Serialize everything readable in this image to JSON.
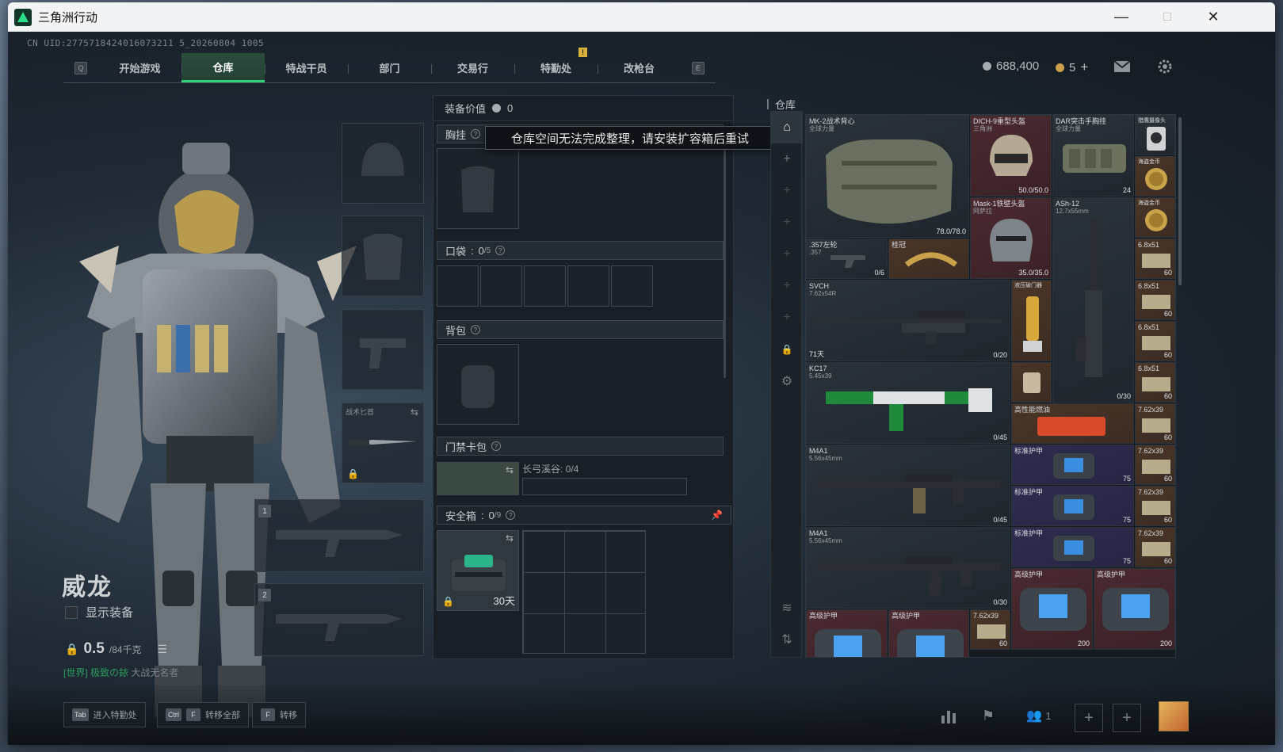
{
  "window": {
    "title": "三角洲行动",
    "minimize": "—",
    "maximize": "☐",
    "close": "✕"
  },
  "uid": "CN UID:2775718424016073211 5_20260804 1005",
  "nav": {
    "left_key": "Q",
    "right_key": "E",
    "tabs": [
      "开始游戏",
      "仓库",
      "特战干员",
      "部门",
      "交易行",
      "特勤处",
      "改枪台"
    ],
    "active_tab": "仓库",
    "notice_badge": "!"
  },
  "currency": {
    "silver": "688,400",
    "gold": "5",
    "gold_add": "+"
  },
  "character": {
    "name": "威龙",
    "show_equipment_label": "显示装备",
    "weight_value": "0.5",
    "weight_max": "/84千克"
  },
  "chat": {
    "tag": "[世界]",
    "user": "极致の銥",
    "text": "大战无名者"
  },
  "slots": {
    "melee_label": "战术匕首",
    "primary_1": "1",
    "primary_2": "2"
  },
  "equip_panel": {
    "header_label": "装备价值",
    "header_value": "0",
    "chest_label": "胸挂",
    "pocket_label": "口袋",
    "pocket_count": "0",
    "pocket_max": "/5",
    "backpack_label": "背包",
    "keycard_label": "门禁卡包",
    "keycard_sub": "长弓溪谷: 0/4",
    "safebox_label": "安全箱",
    "safebox_count": "0",
    "safebox_max": "/9",
    "safebox_days": "30天"
  },
  "tooltip": "仓库空间无法完成整理，请安装扩容箱后重试",
  "stash": {
    "title": "仓库",
    "items": [
      {
        "name": "MK-2战术背心",
        "sub": "全球力量",
        "count": "78.0/78.0",
        "color": "g"
      },
      {
        "name": "DICH-9重型头盔",
        "sub": "三角洲",
        "count": "50.0/50.0",
        "color": "r"
      },
      {
        "name": "DAR突击手胸挂",
        "sub": "全球力量",
        "count": "24",
        "color": "g"
      },
      {
        "name": "Mask-1铁壁头盔",
        "sub": "阿萨拉",
        "count": "35.0/35.0",
        "color": "r"
      },
      {
        "name": "ASh-12",
        "sub": "12.7x55mm",
        "count": "0/30",
        "color": "g"
      },
      {
        "name": ".357左轮",
        "sub": ".357",
        "count": "0/6",
        "color": "g"
      },
      {
        "name": "桂冠",
        "sub": "",
        "count": "",
        "color": "b"
      },
      {
        "name": "SVCH",
        "sub": "7.62x54R",
        "count": "0/20",
        "days": "71天",
        "color": "g"
      },
      {
        "name": "液压破门器",
        "sub": "",
        "count": "",
        "color": "b"
      },
      {
        "name": "KC17",
        "sub": "5.45x39",
        "count": "0/45",
        "color": "gr"
      },
      {
        "name": "高性能燃油",
        "sub": "",
        "count": "",
        "color": "b"
      },
      {
        "name": "M4A1",
        "sub": "5.56x45mm",
        "count": "0/45",
        "color": "g"
      },
      {
        "name": "M4A1",
        "sub": "5.56x45mm",
        "count": "0/30",
        "color": "g"
      },
      {
        "name": "标准护甲",
        "sub": "",
        "count": "75",
        "color": "p"
      },
      {
        "name": "标准护甲",
        "sub": "",
        "count": "75",
        "color": "p"
      },
      {
        "name": "标准护甲",
        "sub": "",
        "count": "75",
        "color": "p"
      },
      {
        "name": "高级护甲",
        "sub": "",
        "count": "200",
        "color": "r"
      },
      {
        "name": "高级护甲",
        "sub": "",
        "count": "200",
        "color": "r"
      },
      {
        "name": "高级护甲",
        "sub": "",
        "count": "",
        "color": "r"
      },
      {
        "name": "高级护甲",
        "sub": "",
        "count": "",
        "color": "r"
      }
    ],
    "ammo_col": [
      {
        "name": "6.8x51",
        "count": "60"
      },
      {
        "name": "6.8x51",
        "count": "60"
      },
      {
        "name": "6.8x51",
        "count": "60"
      },
      {
        "name": "6.8x51",
        "count": "60"
      },
      {
        "name": "7.62x39",
        "count": "60"
      },
      {
        "name": "7.62x39",
        "count": "60"
      },
      {
        "name": "7.62x39",
        "count": "60"
      },
      {
        "name": "7.62x39",
        "count": "60"
      },
      {
        "name": "7.62x39",
        "count": "60"
      }
    ],
    "coins": [
      "海盗金币",
      "海盗金币"
    ],
    "misc": "猎鹰摄像头"
  },
  "bottom": {
    "tab_key": "Tab",
    "tab_label": "进入特勤处",
    "ctrl_key": "Ctrl",
    "f_key": "F",
    "transfer_all_label": "转移全部",
    "f_key2": "F",
    "transfer_label": "转移",
    "friends_count": "1"
  },
  "colors": {
    "accent": "#30d27a",
    "panel": "#191f26",
    "tooltip_bg": "#0f1318"
  }
}
